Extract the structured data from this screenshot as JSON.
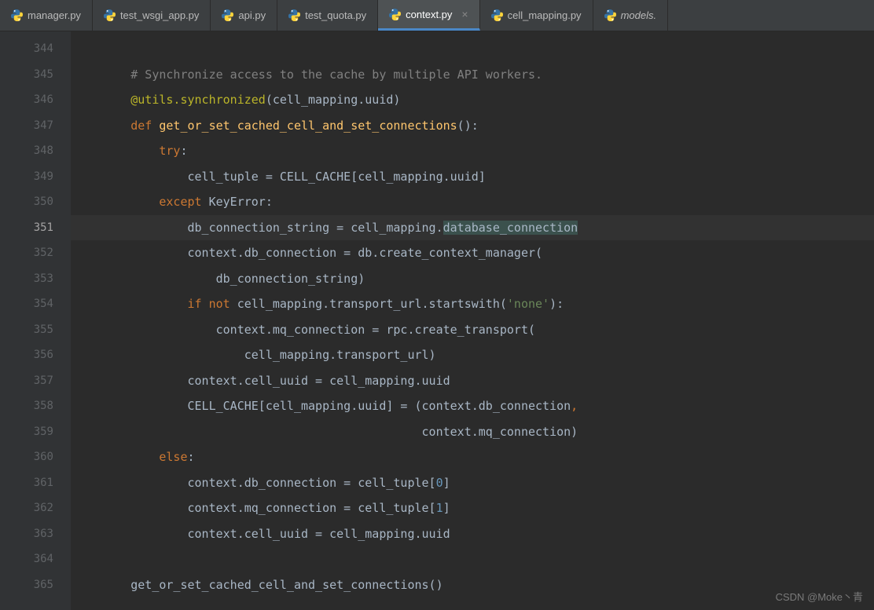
{
  "tabs": [
    {
      "label": "manager.py",
      "active": false
    },
    {
      "label": "test_wsgi_app.py",
      "active": false
    },
    {
      "label": "api.py",
      "active": false
    },
    {
      "label": "test_quota.py",
      "active": false
    },
    {
      "label": "context.py",
      "active": true
    },
    {
      "label": "cell_mapping.py",
      "active": false
    },
    {
      "label": "models.",
      "active": false,
      "italic": true
    }
  ],
  "line_numbers": [
    "344",
    "345",
    "346",
    "347",
    "348",
    "349",
    "350",
    "351",
    "352",
    "353",
    "354",
    "355",
    "356",
    "357",
    "358",
    "359",
    "360",
    "361",
    "362",
    "363",
    "364",
    "365"
  ],
  "current_line": "351",
  "bulb_line": "351",
  "code": {
    "l344": "",
    "l345_indent": "        ",
    "l345_comment": "# Synchronize access to the cache by multiple API workers.",
    "l346_indent": "        ",
    "l346_dec": "@utils.synchronized",
    "l346_args": "(cell_mapping.uuid)",
    "l347_indent": "        ",
    "l347_def": "def ",
    "l347_name": "get_or_set_cached_cell_and_set_connections",
    "l347_rest": "():",
    "l348_indent": "            ",
    "l348_try": "try",
    "l348_colon": ":",
    "l349_indent": "                ",
    "l349_text": "cell_tuple = CELL_CACHE[cell_mapping.uuid]",
    "l350_indent": "            ",
    "l350_except": "except ",
    "l350_err": "KeyError",
    "l350_colon": ":",
    "l351_indent": "                ",
    "l351_a": "db_connection_string = cell_mapping.",
    "l351_b": "database_connection",
    "l352_indent": "                ",
    "l352_text": "context.db_connection = db.create_context_manager(",
    "l353_indent": "                    ",
    "l353_text": "db_connection_string)",
    "l354_indent": "                ",
    "l354_if": "if ",
    "l354_not": "not ",
    "l354_rest": "cell_mapping.transport_url.startswith(",
    "l354_str": "'none'",
    "l354_end": "):",
    "l355_indent": "                    ",
    "l355_text": "context.mq_connection = rpc.create_transport(",
    "l356_indent": "                        ",
    "l356_text": "cell_mapping.transport_url)",
    "l357_indent": "                ",
    "l357_text": "context.cell_uuid = cell_mapping.uuid",
    "l358_indent": "                ",
    "l358_a": "CELL_CACHE[cell_mapping.uuid] = (context.db_connection",
    "l358_comma": ",",
    "l359_indent": "                                                 ",
    "l359_text": "context.mq_connection)",
    "l360_indent": "            ",
    "l360_else": "else",
    "l360_colon": ":",
    "l361_indent": "                ",
    "l361_a": "context.db_connection = cell_tuple[",
    "l361_n": "0",
    "l361_b": "]",
    "l362_indent": "                ",
    "l362_a": "context.mq_connection = cell_tuple[",
    "l362_n": "1",
    "l362_b": "]",
    "l363_indent": "                ",
    "l363_text": "context.cell_uuid = cell_mapping.uuid",
    "l364": "",
    "l365_indent": "        ",
    "l365_text": "get_or_set_cached_cell_and_set_connections()"
  },
  "watermark": "CSDN @Moke丶青"
}
